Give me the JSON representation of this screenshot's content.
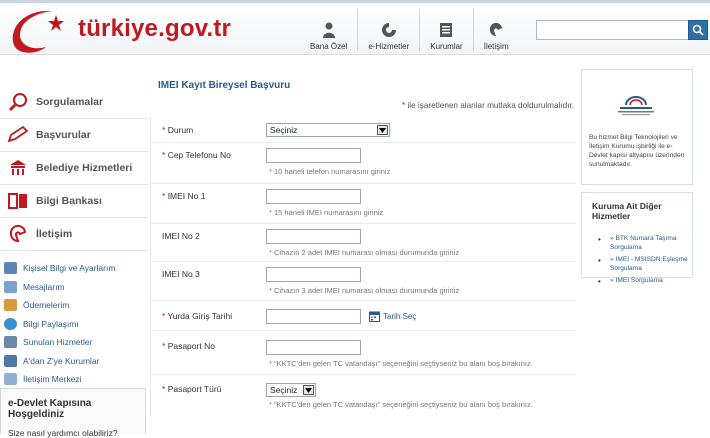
{
  "header": {
    "logo_text": "türkiye.gov.tr",
    "nav": [
      {
        "label": "Bana Özel",
        "icon": "user-icon"
      },
      {
        "label": "e-Hizmetler",
        "icon": "e-services-icon"
      },
      {
        "label": "Kurumlar",
        "icon": "institutions-icon"
      },
      {
        "label": "İletişim",
        "icon": "contact-icon"
      }
    ],
    "search": {
      "placeholder": "",
      "icon": "search-icon"
    }
  },
  "sidebar": {
    "main_items": [
      {
        "label": "Sorgulamalar",
        "icon": "magnifier-icon"
      },
      {
        "label": "Başvurular",
        "icon": "pencil-icon"
      },
      {
        "label": "Belediye Hizmetleri",
        "icon": "building-icon"
      },
      {
        "label": "Bilgi Bankası",
        "icon": "book-icon"
      },
      {
        "label": "İletişim",
        "icon": "chat-icon"
      }
    ],
    "sub_items": [
      {
        "label": "Kişisel Bilgi ve Ayarlarım",
        "icon": "profile-icon"
      },
      {
        "label": "Mesajlarım",
        "icon": "envelope-icon"
      },
      {
        "label": "Ödemelerim",
        "icon": "payment-icon"
      },
      {
        "label": "Bilgi Paylaşımı",
        "icon": "share-icon"
      },
      {
        "label": "Sunulan Hizmetler",
        "icon": "list-icon"
      },
      {
        "label": "A'dan Z'ye Kurumlar",
        "icon": "institutions-list-icon"
      },
      {
        "label": "İletişim Merkezi",
        "icon": "phone-icon"
      }
    ],
    "welcome": {
      "title": "e-Devlet Kapısına Hoşgeldiniz",
      "subtitle": "Size nasıl yardımcı olabiliriz?"
    }
  },
  "main": {
    "title": "IMEI Kayıt Bireysel Başvuru",
    "required_note": {
      "star": "*",
      "text": " ile işaretlenen alanlar mutlaka doldurulmalıdır."
    },
    "calendar_link": "Tarih Seç",
    "fields": [
      {
        "star": "*",
        "label": "Durum",
        "type": "select",
        "value": "Seçiniz",
        "hint": ""
      },
      {
        "star": "*",
        "label": "Cep Telefonu No",
        "type": "text",
        "value": "",
        "hint": "* 10 haneli telefon numarasını giriniz"
      },
      {
        "star": "*",
        "label": "IMEI No 1",
        "type": "text",
        "value": "",
        "hint": "* 15 haneli IMEI numarasını giriniz"
      },
      {
        "star": "",
        "label": "IMEI No 2",
        "type": "text",
        "value": "",
        "hint": "* Cihazın 2 adet IMEI numarası olması durumunda giriniz"
      },
      {
        "star": "",
        "label": "IMEI No 3",
        "type": "text",
        "value": "",
        "hint": "* Cihazın 3 adet IMEI numarası olması durumunda giriniz"
      },
      {
        "star": "*",
        "label": "Yurda Giriş Tarihi",
        "type": "date",
        "value": "",
        "hint": ""
      },
      {
        "star": "*",
        "label": "Pasaport No",
        "type": "text",
        "value": "",
        "hint": "* \"KKTC'den gelen TC vatandaşı\" seçeneğini seçtiyseniz bu alanı boş bırakınız."
      },
      {
        "star": "*",
        "label": "Pasaport Türü",
        "type": "select",
        "value": "Seçiniz",
        "hint": "* \"KKTC'den gelen TC vatandaşı\" seçeneğini seçtiyseniz bu alanı boş bırakınız."
      }
    ]
  },
  "right": {
    "info_text": "Bu hizmet Bilgi Teknolojileri ve İletişim Kurumu işbirliği ile e-Devlet kapısı altyapısı üzerinden sunulmaktadır.",
    "other_services_title": "Kuruma Ait Diğer Hizmetler",
    "links": [
      "» BTK Numara Taşıma Sorgulama",
      "» IMEI - MSISDN Eşleşme Sorgulama",
      "» IMEI Sorgulama"
    ]
  },
  "colors": {
    "brand_red": "#c01920",
    "link_blue": "#2a5b8f",
    "search_blue": "#2f6fa8"
  }
}
